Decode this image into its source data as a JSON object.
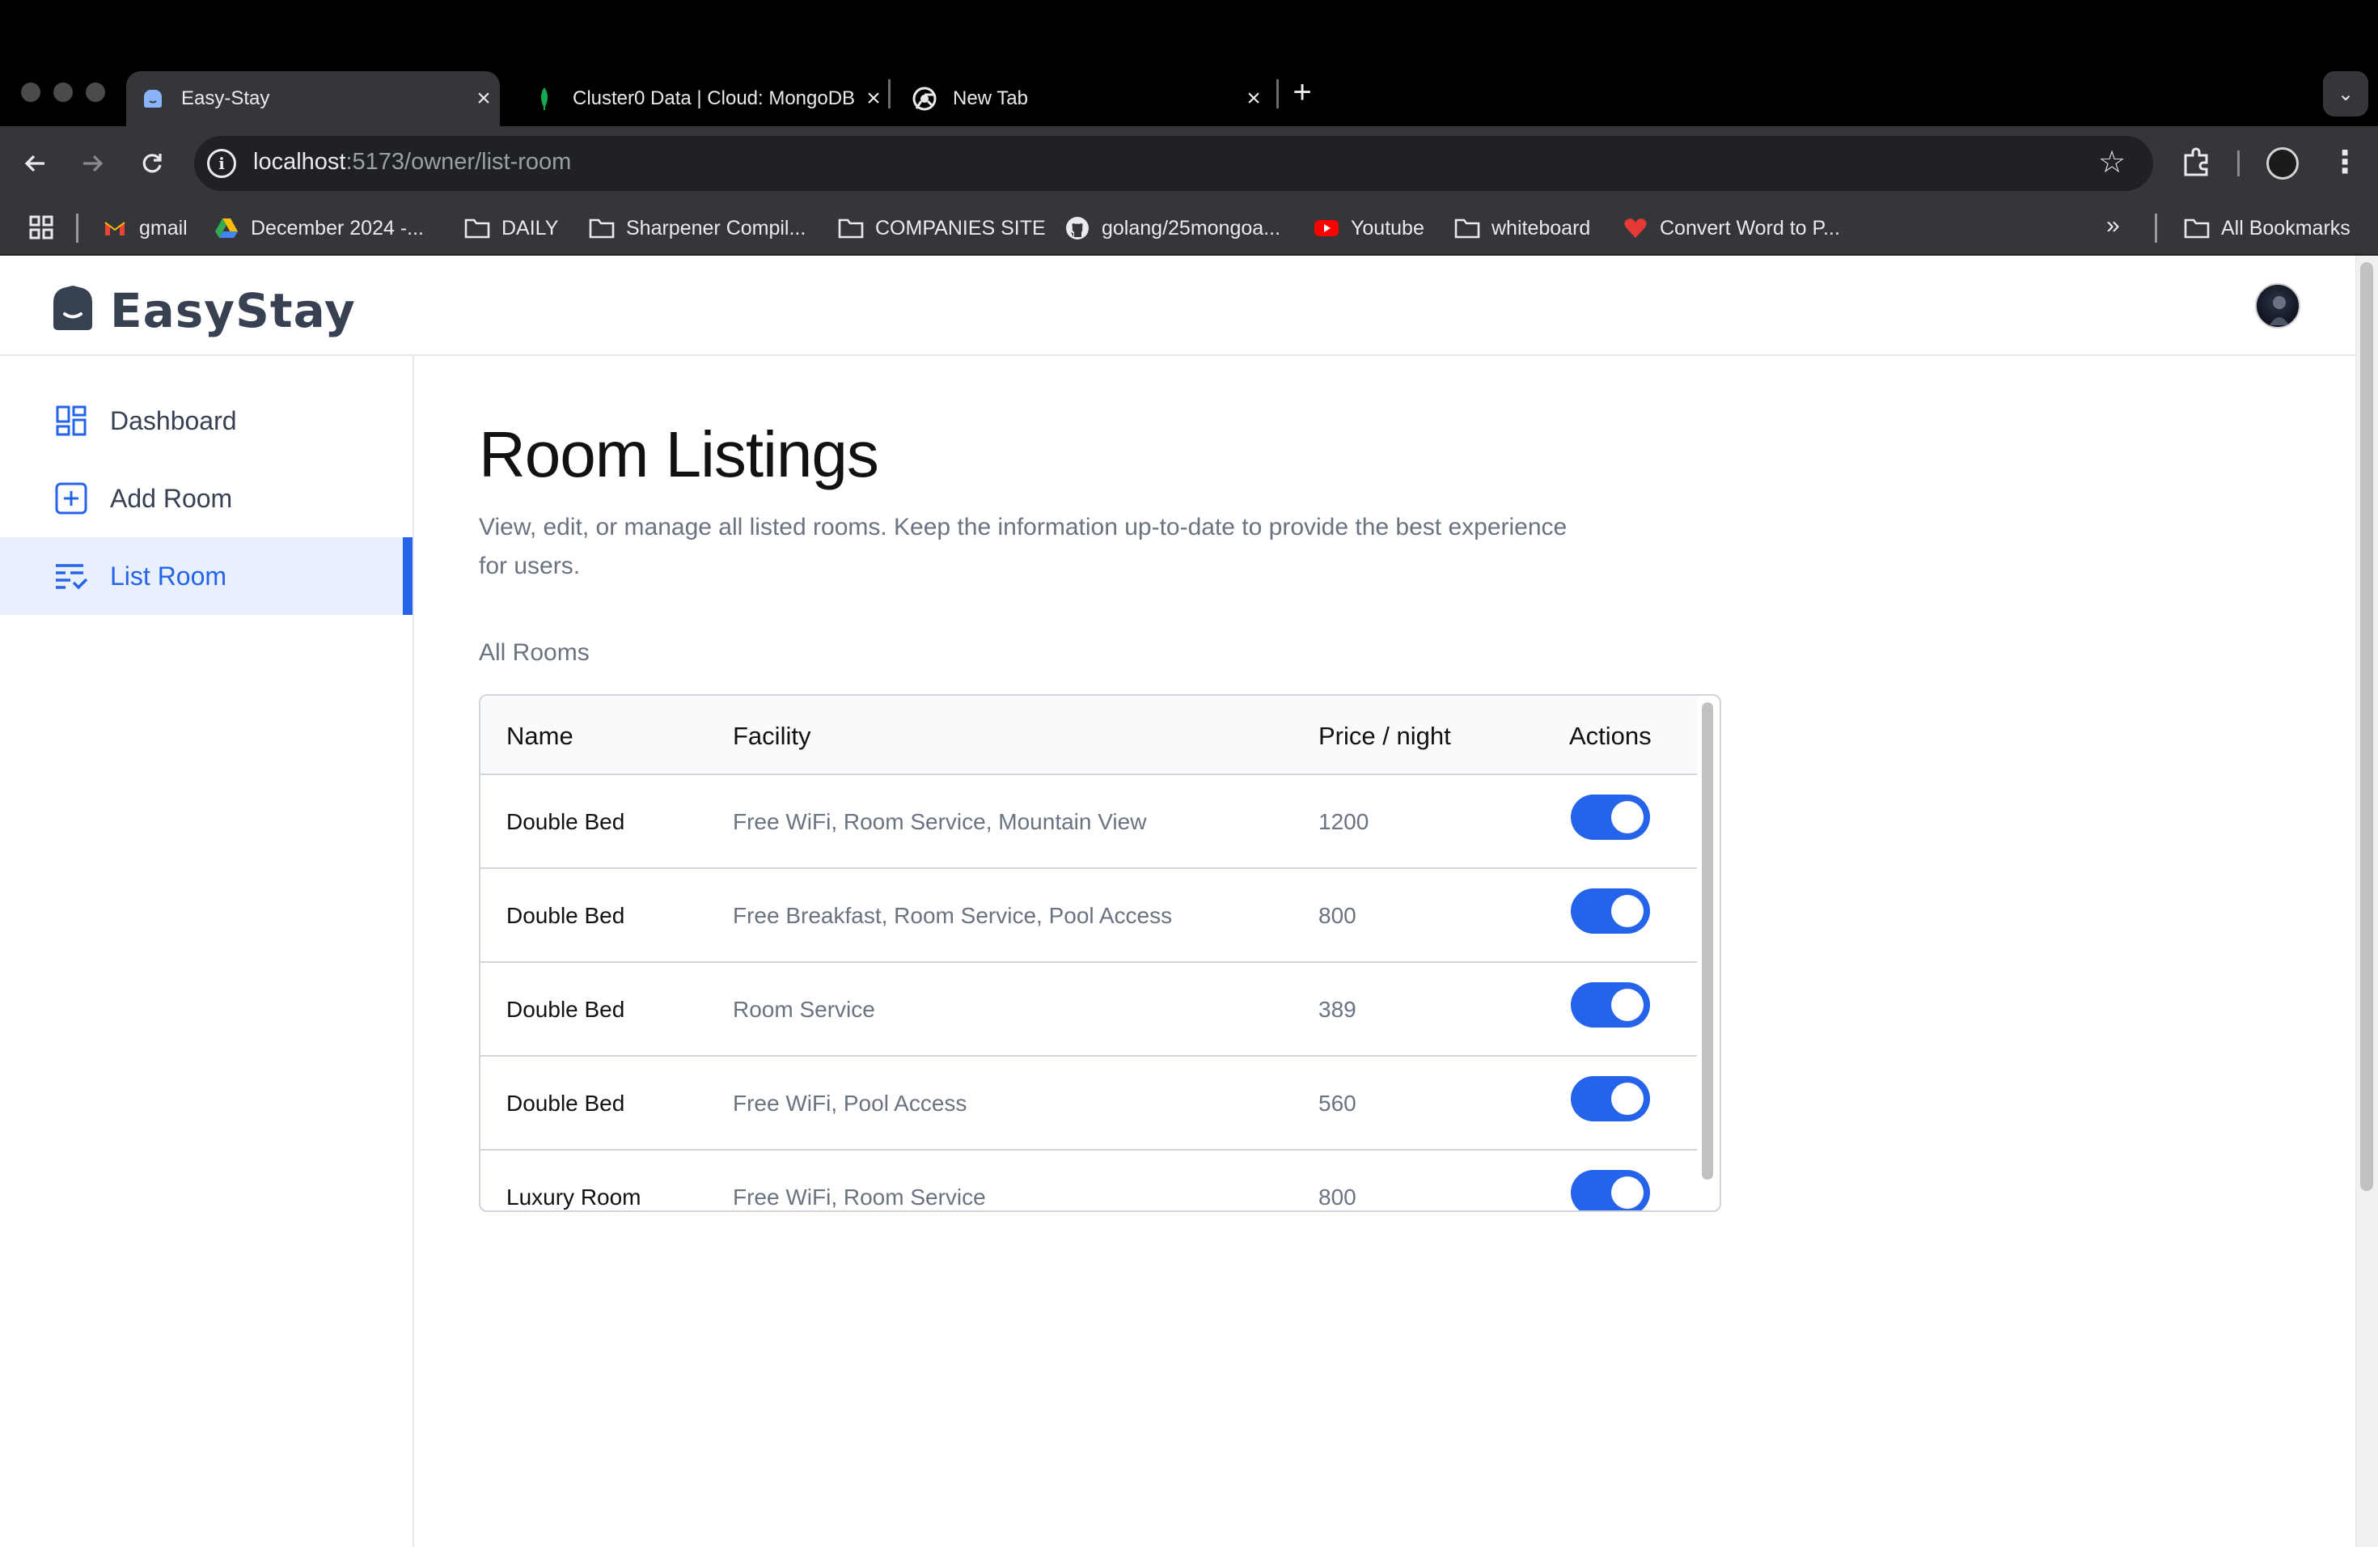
{
  "browser": {
    "tabs": [
      {
        "title": "Easy-Stay",
        "favicon": "easystay-favicon",
        "active": true
      },
      {
        "title": "Cluster0 Data | Cloud: MongoDB",
        "favicon": "mongodb-leaf-icon",
        "active": false
      },
      {
        "title": "New Tab",
        "favicon": "chrome-icon",
        "active": false
      }
    ],
    "url_host": "localhost",
    "url_path": ":5173/owner/list-room",
    "bookmarks": [
      {
        "label": "gmail",
        "icon": "gmail-icon"
      },
      {
        "label": "December 2024 -...",
        "icon": "google-drive-icon"
      },
      {
        "label": "DAILY",
        "icon": "folder-icon"
      },
      {
        "label": "Sharpener Compil...",
        "icon": "folder-icon"
      },
      {
        "label": "COMPANIES SITE",
        "icon": "folder-icon"
      },
      {
        "label": "golang/25mongoa...",
        "icon": "github-icon"
      },
      {
        "label": "Youtube",
        "icon": "youtube-icon"
      },
      {
        "label": "whiteboard",
        "icon": "folder-icon"
      },
      {
        "label": "Convert Word to P...",
        "icon": "heart-icon"
      }
    ],
    "all_bookmarks": "All Bookmarks"
  },
  "app": {
    "brand": "EasyStay",
    "sidebar": [
      {
        "label": "Dashboard",
        "icon": "dashboard-icon",
        "active": false
      },
      {
        "label": "Add Room",
        "icon": "add-room-icon",
        "active": false
      },
      {
        "label": "List Room",
        "icon": "list-room-icon",
        "active": true
      }
    ],
    "title": "Room Listings",
    "subtitle": "View, edit, or manage all listed rooms. Keep the information up-to-date to provide the best experience for users.",
    "section_label": "All Rooms",
    "table": {
      "headers": [
        "Name",
        "Facility",
        "Price / night",
        "Actions"
      ],
      "rows": [
        {
          "name": "Double Bed",
          "facility": "Free WiFi, Room Service, Mountain View",
          "price": "1200",
          "available": true
        },
        {
          "name": "Double Bed",
          "facility": "Free Breakfast, Room Service, Pool Access",
          "price": "800",
          "available": true
        },
        {
          "name": "Double Bed",
          "facility": "Room Service",
          "price": "389",
          "available": true
        },
        {
          "name": "Double Bed",
          "facility": "Free WiFi, Pool Access",
          "price": "560",
          "available": true
        },
        {
          "name": "Luxury Room",
          "facility": "Free WiFi, Room Service",
          "price": "800",
          "available": true
        }
      ]
    }
  },
  "colors": {
    "accent": "#2563eb",
    "active_bg": "#e8f0fe",
    "chrome_dark": "#35363a"
  }
}
